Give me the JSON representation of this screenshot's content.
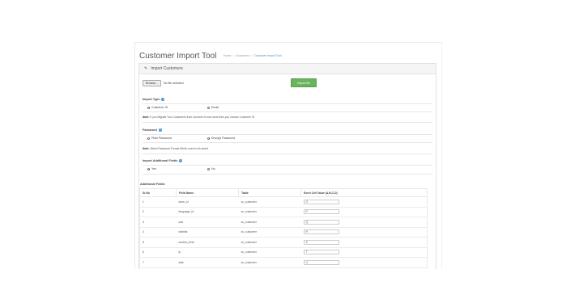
{
  "header": {
    "title": "Customer Import Tool",
    "breadcrumb": [
      "Home",
      "Customers",
      "Customer Import Tool"
    ]
  },
  "panel": {
    "title": "Import Customers",
    "file": {
      "browse_label": "Browse...",
      "status": "No file selected."
    },
    "import_button": "Import file"
  },
  "import_type": {
    "label": "Import Type",
    "options": [
      {
        "label": "Customer ID",
        "selected": true
      },
      {
        "label": "Email",
        "selected": false
      }
    ],
    "note_bold": "Note:",
    "note": " If you Migrate Your Customers from old store to new store then you choose Customer ID"
  },
  "password": {
    "label": "Password",
    "options": [
      {
        "label": "Plain Password",
        "selected": false
      },
      {
        "label": "Encrypt Password",
        "selected": true
      }
    ],
    "note_bold": "Note:",
    "note": " Select Password Format Which used in xls sheet."
  },
  "additional": {
    "label": "Import Additional Fields",
    "options": [
      {
        "label": "Yes",
        "selected": true
      },
      {
        "label": "No",
        "selected": false
      }
    ]
  },
  "fields_table": {
    "title": "Additional Fields",
    "headers": [
      "Sr.No",
      "Field Name",
      "Table",
      "Excel Cell Value (A,B,C,D)"
    ],
    "rows": [
      {
        "no": "1",
        "field": "store_id",
        "table": "oc_customer",
        "value": "O"
      },
      {
        "no": "2",
        "field": "language_id",
        "table": "oc_customer",
        "value": "P"
      },
      {
        "no": "3",
        "field": "cart",
        "table": "oc_customer",
        "value": "Q"
      },
      {
        "no": "4",
        "field": "wishlist",
        "table": "oc_customer",
        "value": "R"
      },
      {
        "no": "5",
        "field": "custom_field",
        "table": "oc_customer",
        "value": "S"
      },
      {
        "no": "6",
        "field": "ip",
        "table": "oc_customer",
        "value": "T"
      },
      {
        "no": "7",
        "field": "safe",
        "table": "oc_customer",
        "value": "U"
      }
    ]
  },
  "colors": {
    "accent": "#3a8fd4",
    "button_green": "#6bb35c"
  }
}
